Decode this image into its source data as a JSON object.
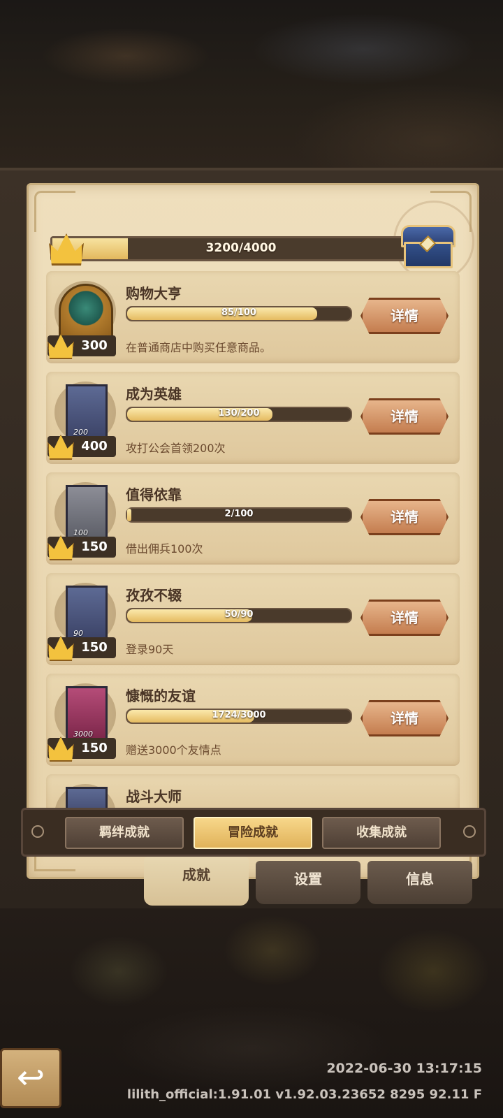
{
  "overall": {
    "progress_text": "3200/4000",
    "progress_fraction": 0.2
  },
  "achievements": [
    {
      "title": "购物大亨",
      "progress": "85/100",
      "fraction": 0.85,
      "reward": "300",
      "desc": "在普通商店中购买任意商品。",
      "icon": "scale-emblem-icon",
      "icon_num": ""
    },
    {
      "title": "成为英雄",
      "progress": "130/200",
      "fraction": 0.65,
      "reward": "400",
      "desc": "攻打公会首领200次",
      "icon": "sword-card-icon",
      "icon_num": "200"
    },
    {
      "title": "值得依靠",
      "progress": "2/100",
      "fraction": 0.02,
      "reward": "150",
      "desc": "借出佣兵100次",
      "icon": "scroll-card-icon",
      "icon_num": "100"
    },
    {
      "title": "孜孜不辍",
      "progress": "50/90",
      "fraction": 0.56,
      "reward": "150",
      "desc": "登录90天",
      "icon": "clock-card-icon",
      "icon_num": "90"
    },
    {
      "title": "慷慨的友谊",
      "progress": "1724/3000",
      "fraction": 0.57,
      "reward": "150",
      "desc": "赠送3000个友情点",
      "icon": "heart-card-icon",
      "icon_num": "3000"
    },
    {
      "title": "战斗大师",
      "progress": "",
      "fraction": 0,
      "reward": "",
      "desc": "",
      "icon": "battle-card-icon",
      "icon_num": ""
    }
  ],
  "detail_label": "详情",
  "categories": [
    "羁绊成就",
    "冒险成就",
    "收集成就"
  ],
  "active_category": 1,
  "tabs": [
    "成就",
    "设置",
    "信息"
  ],
  "active_tab": 0,
  "footer": {
    "timestamp": "2022-06-30 13:17:15",
    "version": "lilith_official:1.91.01  v1.92.03.23652 8295 92.11 F"
  }
}
